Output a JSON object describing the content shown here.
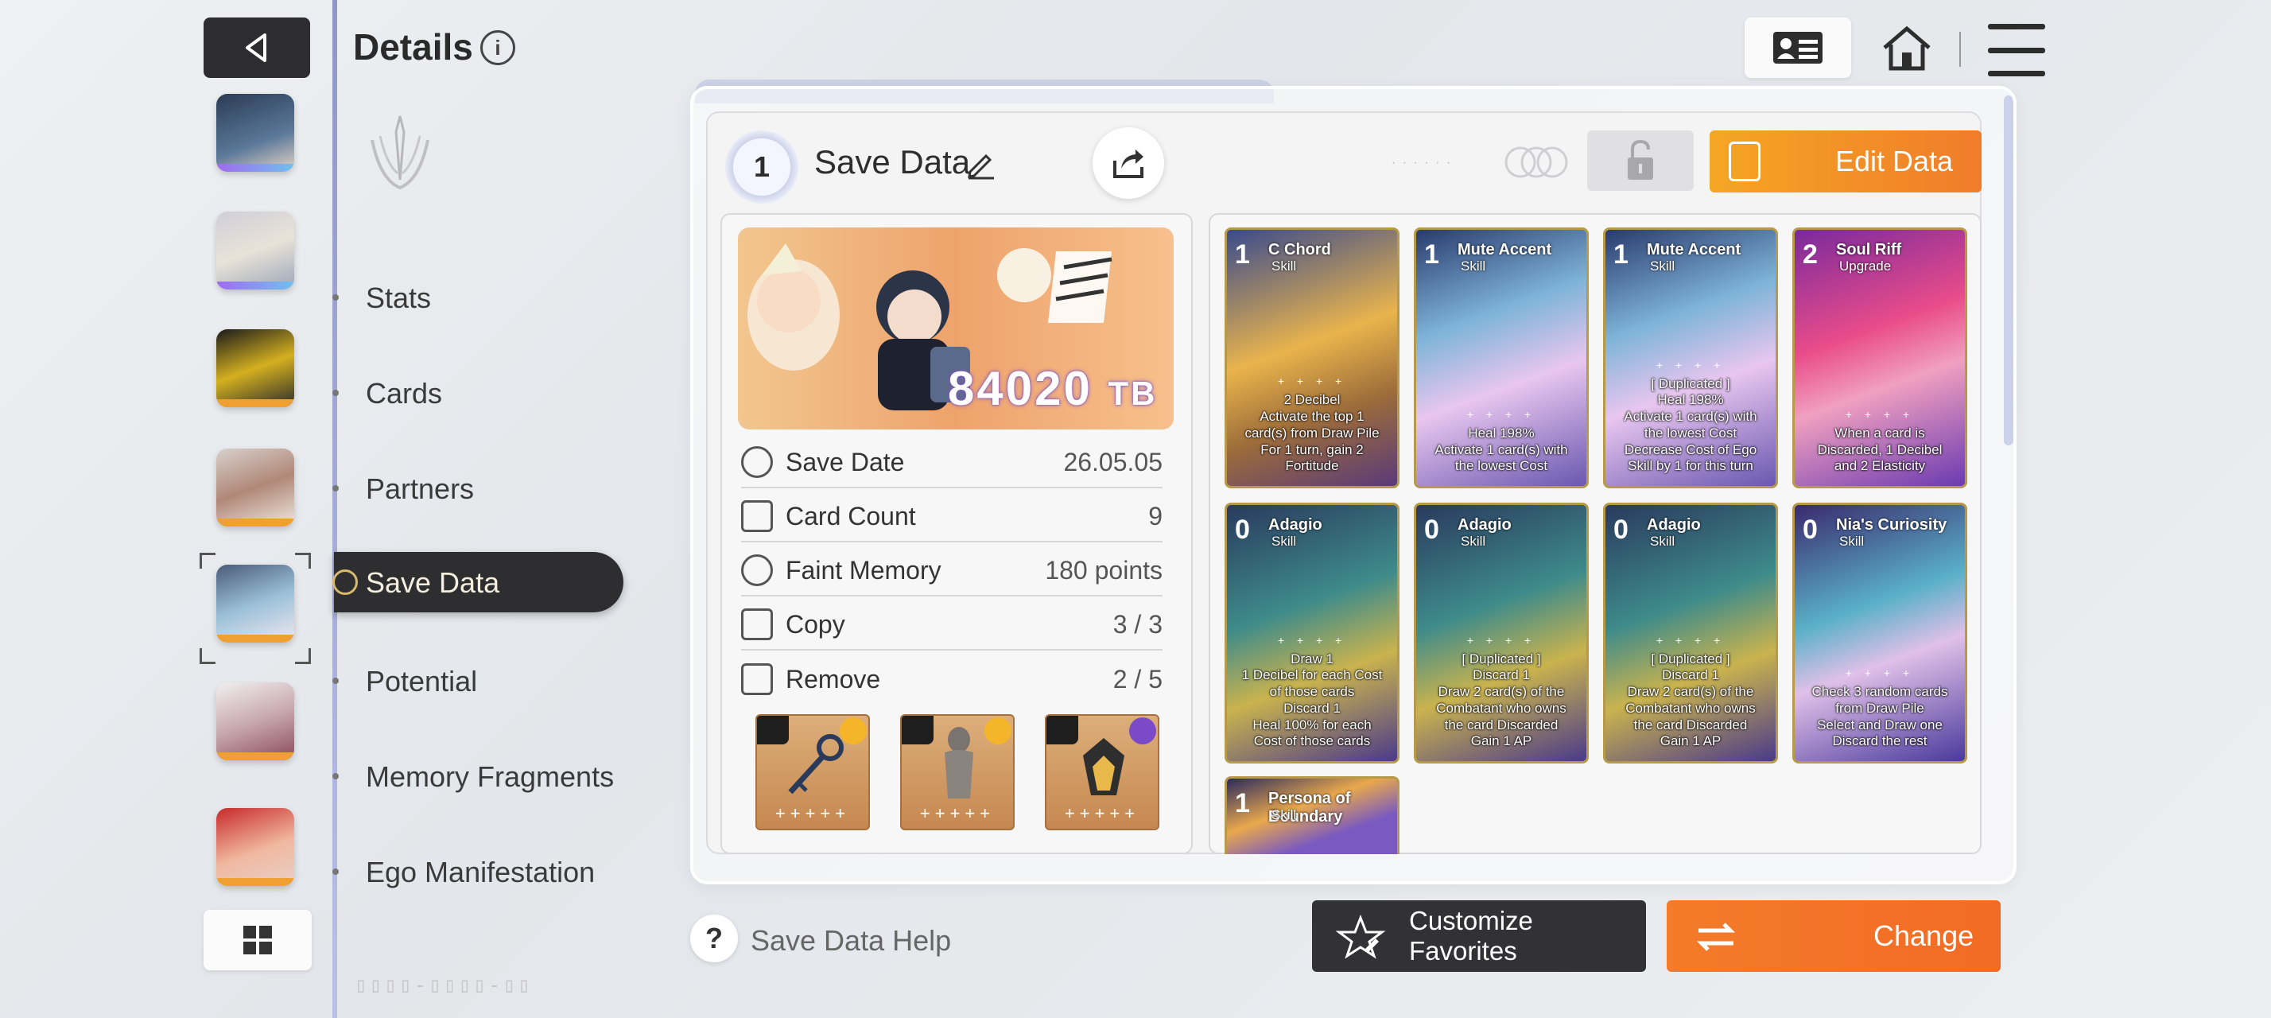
{
  "header": {
    "title": "Details",
    "info_icon": "info-icon"
  },
  "nav": {
    "items": [
      {
        "label": "Stats"
      },
      {
        "label": "Cards"
      },
      {
        "label": "Partners"
      },
      {
        "label": "Save Data"
      },
      {
        "label": "Potential"
      },
      {
        "label": "Memory Fragments"
      },
      {
        "label": "Ego Manifestation"
      }
    ],
    "active": "Save Data"
  },
  "save": {
    "slot_number": "1",
    "title": "Save Data",
    "edit_label": "Edit Data",
    "tb_value": "84020",
    "tb_unit": "TB",
    "stats": [
      {
        "label": "Save Date",
        "value": "26.05.05",
        "icon": "clock-icon"
      },
      {
        "label": "Card Count",
        "value": "9",
        "icon": "card-icon"
      },
      {
        "label": "Faint Memory",
        "value": "180 points",
        "icon": "brain-icon"
      },
      {
        "label": "Copy",
        "value": "3 / 3",
        "icon": "copy-icon"
      },
      {
        "label": "Remove",
        "value": "2 / 5",
        "icon": "remove-icon"
      }
    ]
  },
  "cards": [
    {
      "cost": "1",
      "name": "C Chord",
      "type": "Skill",
      "desc": "2 Decibel\nActivate the top 1 card(s) from Draw Pile\nFor 1 turn, gain 2 Fortitude",
      "bg": "linear-gradient(160deg,#3a4b8c,#e9b44c 45%,#9c6c3a 70%,#5a3a7a)"
    },
    {
      "cost": "1",
      "name": "Mute Accent",
      "type": "Skill",
      "desc": "Heal 198%\nActivate 1 card(s) with the lowest Cost",
      "bg": "linear-gradient(160deg,#2a3b6e,#7fb4d8 35%,#e8c6ef 60%,#6a58b0)"
    },
    {
      "cost": "1",
      "name": "Mute Accent",
      "type": "Skill",
      "desc": "[ Duplicated ]\nHeal 198%\nActivate 1 card(s) with the lowest Cost\nDecrease Cost of Ego Skill by 1 for this turn",
      "bg": "linear-gradient(160deg,#2a3b6e,#7fb4d8 35%,#e8c6ef 60%,#6a58b0)"
    },
    {
      "cost": "2",
      "name": "Soul Riff",
      "type": "Upgrade",
      "desc": "When a card is Discarded, 1 Decibel and 2 Elasticity",
      "bg": "linear-gradient(160deg,#7a2a9c,#e94c8a 40%,#f0a0c0 60%,#6a3ab0)"
    },
    {
      "cost": "0",
      "name": "Adagio",
      "type": "Skill",
      "desc": "Draw 1\n1 Decibel for each Cost of those cards\nDiscard 1\nHeal 100% for each Cost of those cards",
      "bg": "linear-gradient(160deg,#2a3a5e,#3e8b8a 40%,#c9b34e 65%,#4b3a8a)"
    },
    {
      "cost": "0",
      "name": "Adagio",
      "type": "Skill",
      "desc": "[ Duplicated ]\nDiscard 1\nDraw 2 card(s) of the Combatant who owns the card Discarded\nGain 1 AP",
      "bg": "linear-gradient(160deg,#2a3a5e,#3e8b8a 40%,#c9b34e 65%,#4b3a8a)"
    },
    {
      "cost": "0",
      "name": "Adagio",
      "type": "Skill",
      "desc": "[ Duplicated ]\nDiscard 1\nDraw 2 card(s) of the Combatant who owns the card Discarded\nGain 1 AP",
      "bg": "linear-gradient(160deg,#2a3a5e,#3e8b8a 40%,#c9b34e 65%,#4b3a8a)"
    },
    {
      "cost": "0",
      "name": "Nia's Curiosity",
      "type": "Skill",
      "desc": "Check 3 random cards from Draw Pile\nSelect and Draw one\nDiscard the rest",
      "bg": "linear-gradient(160deg,#3a2a6e,#5ab0c8 40%,#e0c0e8 60%,#4a3a9c)"
    },
    {
      "cost": "1",
      "name": "Persona of Boundary",
      "type": "Skill",
      "desc": "",
      "bg": "linear-gradient(160deg,#2a2a5e,#e9a84c 40%,#7a5ac0 70%)"
    }
  ],
  "footer": {
    "help_label": "Save Data Help",
    "favorites_label": "Customize Favorites",
    "change_label": "Change"
  },
  "colors": {
    "accent_orange": "#f07c2a",
    "dark_button": "#323234",
    "rail": "#8f97c9"
  }
}
